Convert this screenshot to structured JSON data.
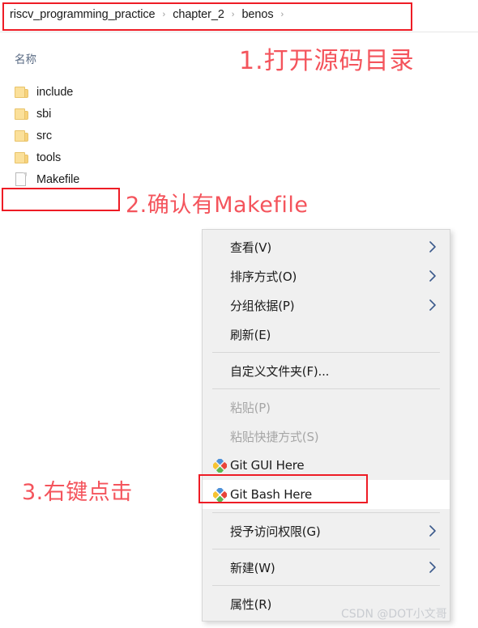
{
  "breadcrumb": {
    "crumbs": [
      "riscv_programming_practice",
      "chapter_2",
      "benos"
    ],
    "separator": "›",
    "trailing_separator": "›"
  },
  "file_pane": {
    "column_header": "名称",
    "items": [
      {
        "name": "include",
        "kind": "folder"
      },
      {
        "name": "sbi",
        "kind": "folder"
      },
      {
        "name": "src",
        "kind": "folder"
      },
      {
        "name": "tools",
        "kind": "folder"
      },
      {
        "name": "Makefile",
        "kind": "file"
      }
    ]
  },
  "annotations": [
    {
      "id": "step1",
      "text": "1.打开源码目录"
    },
    {
      "id": "step2",
      "text": "2.确认有Makefile"
    },
    {
      "id": "step3",
      "text": "3.右键点击"
    }
  ],
  "context_menu": {
    "items": [
      {
        "label": "查看(V)",
        "submenu": true,
        "disabled": false,
        "icon": null,
        "highlight": false,
        "sep_after": false
      },
      {
        "label": "排序方式(O)",
        "submenu": true,
        "disabled": false,
        "icon": null,
        "highlight": false,
        "sep_after": false
      },
      {
        "label": "分组依据(P)",
        "submenu": true,
        "disabled": false,
        "icon": null,
        "highlight": false,
        "sep_after": false
      },
      {
        "label": "刷新(E)",
        "submenu": false,
        "disabled": false,
        "icon": null,
        "highlight": false,
        "sep_after": true
      },
      {
        "label": "自定义文件夹(F)...",
        "submenu": false,
        "disabled": false,
        "icon": null,
        "highlight": false,
        "sep_after": true
      },
      {
        "label": "粘贴(P)",
        "submenu": false,
        "disabled": true,
        "icon": null,
        "highlight": false,
        "sep_after": false
      },
      {
        "label": "粘贴快捷方式(S)",
        "submenu": false,
        "disabled": true,
        "icon": null,
        "highlight": false,
        "sep_after": false
      },
      {
        "label": "Git GUI Here",
        "submenu": false,
        "disabled": false,
        "icon": "git-icon",
        "highlight": false,
        "sep_after": false
      },
      {
        "label": "Git Bash Here",
        "submenu": false,
        "disabled": false,
        "icon": "git-icon",
        "highlight": true,
        "sep_after": true
      },
      {
        "label": "授予访问权限(G)",
        "submenu": true,
        "disabled": false,
        "icon": null,
        "highlight": false,
        "sep_after": true
      },
      {
        "label": "新建(W)",
        "submenu": true,
        "disabled": false,
        "icon": null,
        "highlight": false,
        "sep_after": true
      },
      {
        "label": "属性(R)",
        "submenu": false,
        "disabled": false,
        "icon": null,
        "highlight": false,
        "sep_after": false
      }
    ]
  },
  "watermark": {
    "text": "CSDN @DOT小文哥"
  },
  "colors": {
    "annotation_red": "#f4545c",
    "highlight_box_red": "#ee1c25",
    "menu_background": "#f0f0f0",
    "folder_yellow": "#fbe09a",
    "column_header_text": "#5a6b84",
    "watermark_grey": "#c9ccd1"
  }
}
